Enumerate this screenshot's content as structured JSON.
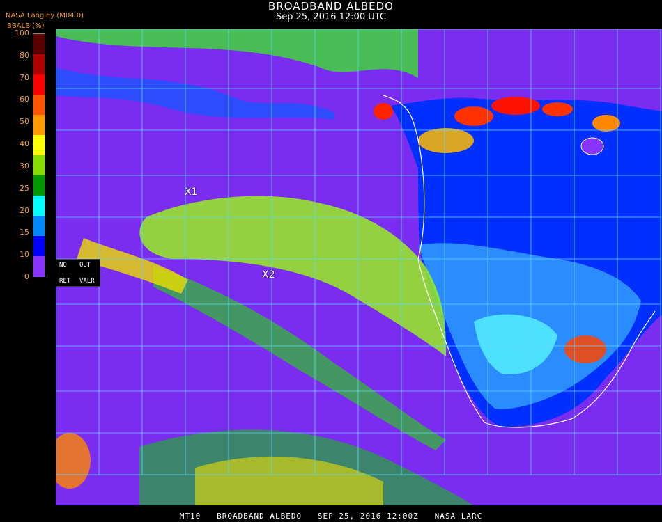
{
  "header": {
    "title": "BROADBAND ALBEDO",
    "datetime": "Sep 25, 2016 12:00 UTC",
    "credit": "NASA Langley (M04.0)",
    "unit_label": "BBALB (%)"
  },
  "legend": {
    "ticks": [
      "100",
      "80",
      "70",
      "60",
      "50",
      "40",
      "30",
      "25",
      "20",
      "15",
      "10",
      "0"
    ],
    "colors": [
      "#5a0000",
      "#b00000",
      "#ff0000",
      "#ff5500",
      "#ff9900",
      "#ffff00",
      "#88dd00",
      "#009900",
      "#00ffff",
      "#0088ff",
      "#0000ff",
      "#8833ff"
    ]
  },
  "map": {
    "ocean_color": "#7a2cf0",
    "land_color": "#0030ff",
    "desert_color": "#2a8cff",
    "grid_color": "#5ad8ff",
    "coastline_color": "#ffffff"
  },
  "no_data_key": {
    "no": "NO",
    "out": "OUT",
    "ret": "RET",
    "valr": "VALR"
  },
  "markers": [
    {
      "label": "X1"
    },
    {
      "label": "X2"
    }
  ],
  "footer": "MT10   BROADBAND ALBEDO   SEP 25, 2016 12:00Z   NASA LARC"
}
